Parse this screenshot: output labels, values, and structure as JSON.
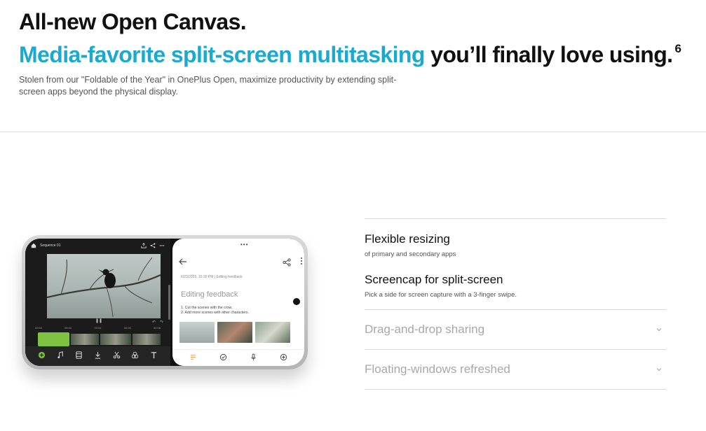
{
  "hero": {
    "headline_line1": "All-new Open Canvas.",
    "headline_accent": "Media-favorite split-screen multitasking",
    "headline_rest": " you’ll finally love using.",
    "footnote": "6",
    "description": "Stolen from our \"Foldable of the Year\" in OnePlus Open, maximize productivity by extending split-screen apps beyond the physical display.",
    "accent_color": "#1ba9cf"
  },
  "phone": {
    "left_app": {
      "sequence_label": "Sequence 01",
      "tick_labels": [
        "00:00",
        "00:02",
        "00:04",
        "00:06",
        "00:08"
      ],
      "icons": [
        "home-icon",
        "export-icon",
        "share-icon",
        "more-icon",
        "add-clip-icon",
        "music-icon",
        "film-icon",
        "download-icon",
        "scissors-icon",
        "filters-icon",
        "text-icon"
      ],
      "timeline_accent": "#7fc242"
    },
    "right_app": {
      "meta": "6/23/2025, 15:30 PM  |  Editing feedback",
      "title": "Editing feedback",
      "note_line1": "1. Cut the scenes with the crow.",
      "note_line2": "2. Add more scenes with other characters."
    }
  },
  "features": [
    {
      "title": "Flexible resizing",
      "subtitle": "of primary and secondary apps",
      "expanded": true
    },
    {
      "title": "Screencap for split-screen",
      "subtitle": "Pick a side for screen capture with a 3-finger swipe.",
      "expanded": true
    },
    {
      "title": "Drag-and-drop sharing",
      "expanded": false
    },
    {
      "title": "Floating-windows refreshed",
      "expanded": false
    }
  ]
}
